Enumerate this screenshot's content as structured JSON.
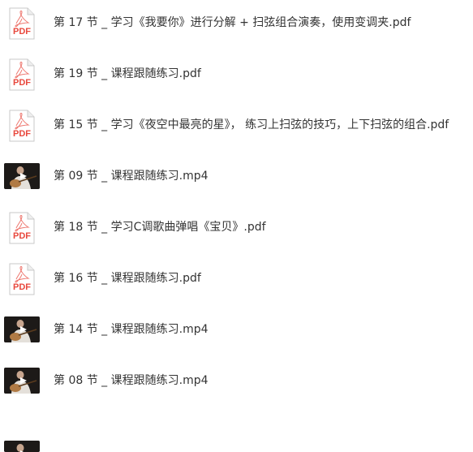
{
  "files": [
    {
      "name": "第 17 节 _ 学习《我要你》进行分解 + 扫弦组合演奏，使用变调夹.pdf",
      "type": "pdf",
      "icon": "pdf-file-icon"
    },
    {
      "name": "第 19 节 _ 课程跟随练习.pdf",
      "type": "pdf",
      "icon": "pdf-file-icon"
    },
    {
      "name": "第 15 节 _ 学习《夜空中最亮的星》， 练习上扫弦的技巧，上下扫弦的组合.pdf",
      "type": "pdf",
      "icon": "pdf-file-icon"
    },
    {
      "name": "第 09 节 _ 课程跟随练习.mp4",
      "type": "mp4",
      "icon": "video-thumbnail"
    },
    {
      "name": "第 18 节 _ 学习C调歌曲弹唱《宝贝》.pdf",
      "type": "pdf",
      "icon": "pdf-file-icon"
    },
    {
      "name": "第 16 节 _ 课程跟随练习.pdf",
      "type": "pdf",
      "icon": "pdf-file-icon"
    },
    {
      "name": "第 14 节 _ 课程跟随练习.mp4",
      "type": "mp4",
      "icon": "video-thumbnail"
    },
    {
      "name": "第 08 节 _ 课程跟随练习.mp4",
      "type": "mp4",
      "icon": "video-thumbnail"
    },
    {
      "name": "",
      "type": "mp4",
      "icon": "video-thumbnail"
    }
  ],
  "pdf_icon_label": "PDF",
  "colors": {
    "pdf_red": "#e8483d",
    "pdf_page": "#ffffff",
    "pdf_border": "#c9c9c9",
    "text": "#333333",
    "video_dark": "#1a1a1a"
  }
}
